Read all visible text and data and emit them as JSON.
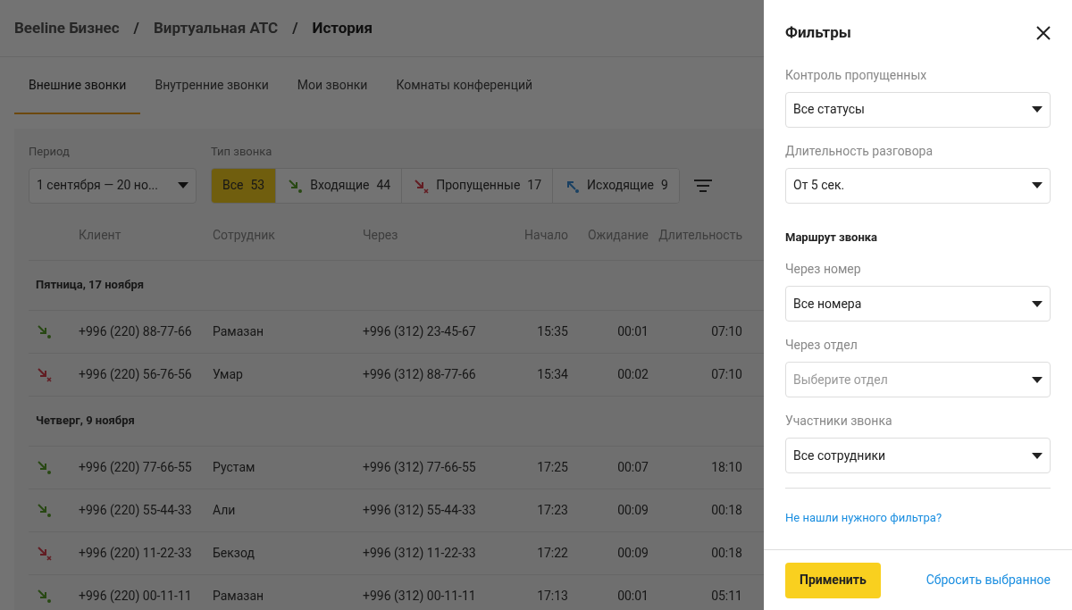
{
  "breadcrumbs": [
    "Beeline Бизнес",
    "Виртуальная АТС",
    "История"
  ],
  "breadcrumb_separators": [
    "/",
    "/"
  ],
  "tabs": [
    {
      "label": "Внешние звонки",
      "selected": true
    },
    {
      "label": "Внутренние звонки",
      "selected": false
    },
    {
      "label": "Мои звонки",
      "selected": false
    },
    {
      "label": "Комнаты конференций",
      "selected": false
    }
  ],
  "period": {
    "label": "Период",
    "value": "1 сентября — 20 но..."
  },
  "call_type": {
    "label": "Тип звонка",
    "options": [
      {
        "kind": "all",
        "label": "Все",
        "count": "53",
        "selected": true
      },
      {
        "kind": "incoming",
        "label": "Входящие",
        "count": "44",
        "selected": false
      },
      {
        "kind": "missed",
        "label": "Пропущенные",
        "count": "17",
        "selected": false
      },
      {
        "kind": "outgoing",
        "label": "Исходящие",
        "count": "9",
        "selected": false
      }
    ]
  },
  "table": {
    "columns": [
      "Клиент",
      "Сотрудник",
      "Через",
      "Начало",
      "Ожидание",
      "Длительность"
    ],
    "groups": [
      {
        "title": "Пятница, 17 ноября",
        "rows": [
          {
            "kind": "incoming",
            "client": "+996 (220) 88-77-66",
            "employee": "Рамазан",
            "via": "+996 (312) 23-45-67",
            "start": "15:35",
            "wait": "00:01",
            "duration": "07:10"
          },
          {
            "kind": "missed",
            "client": "+996 (220) 56-76-56",
            "employee": "Умар",
            "via": "+996 (312) 88-77-66",
            "start": "15:34",
            "wait": "00:02",
            "duration": "07:10"
          }
        ]
      },
      {
        "title": "Четверг, 9 ноября",
        "rows": [
          {
            "kind": "incoming",
            "client": "+996 (220) 77-66-55",
            "employee": "Рустам",
            "via": "+996 (312) 77-66-55",
            "start": "17:25",
            "wait": "00:07",
            "duration": "18:10"
          },
          {
            "kind": "incoming",
            "client": "+996 (220) 55-44-33",
            "employee": "Али",
            "via": "+996 (312) 55-44-33",
            "start": "17:23",
            "wait": "00:09",
            "duration": "00:18"
          },
          {
            "kind": "missed",
            "client": "+996 (220) 11-22-33",
            "employee": "Бекзод",
            "via": "+996 (312) 11-22-33",
            "start": "17:22",
            "wait": "00:09",
            "duration": "00:18"
          },
          {
            "kind": "incoming",
            "client": "+996 (220) 00-11-11",
            "employee": "Рамазан",
            "via": "+996 (312) 00-11-11",
            "start": "17:13",
            "wait": "00:01",
            "duration": "05:11"
          }
        ]
      }
    ]
  },
  "filters_panel": {
    "title": "Фильтры",
    "sections": [
      {
        "kind": "select",
        "label": "Контроль пропущенных",
        "value": "Все статусы"
      },
      {
        "kind": "select",
        "label": "Длительность разговора",
        "value": "От 5 сек."
      },
      {
        "kind": "heading",
        "label": "Маршрут звонка"
      },
      {
        "kind": "select",
        "label": "Через номер",
        "value": "Все номера"
      },
      {
        "kind": "select",
        "label": "Через отдел",
        "placeholder": "Выберите отдел"
      },
      {
        "kind": "select",
        "label": "Участники звонка",
        "value": "Все сотрудники"
      }
    ],
    "help_link": "Не нашли нужного фильтра?",
    "apply_button": "Применить",
    "reset_link": "Сбросить выбранное"
  }
}
